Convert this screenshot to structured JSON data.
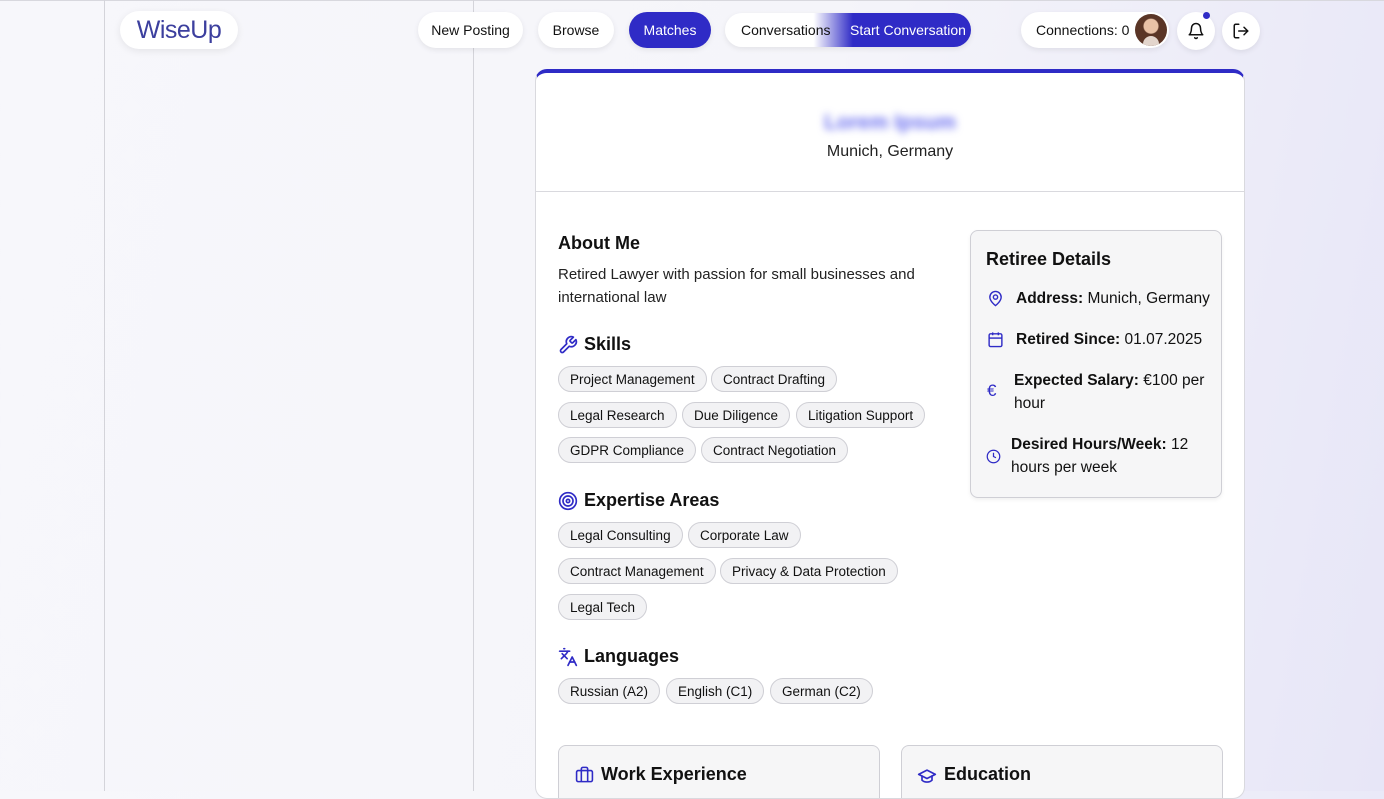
{
  "brand": {
    "logo_text": "WiseUp",
    "accent": "#2f2bc6"
  },
  "nav": {
    "new_posting": "New Posting",
    "browse": "Browse",
    "matches": "Matches",
    "conversations": "Conversations",
    "start_conversation": "Start Conversation",
    "connections": "Connections: 0"
  },
  "profile": {
    "name": "Lorem Ipsum",
    "location": "Munich, Germany",
    "about_title": "About Me",
    "about_text": "Retired Lawyer with passion for small businesses and international law",
    "skills_title": "Skills",
    "skills": [
      "Project Management",
      "Contract Drafting",
      "Legal Research",
      "Due Diligence",
      "Litigation Support",
      "GDPR Compliance",
      "Contract Negotiation"
    ],
    "expertise_title": "Expertise Areas",
    "expertise": [
      "Legal Consulting",
      "Corporate Law",
      "Contract Management",
      "Privacy & Data Protection",
      "Legal Tech"
    ],
    "languages_title": "Languages",
    "languages": [
      "Russian (A2)",
      "English (C1)",
      "German (C2)"
    ],
    "work_title": "Work Experience",
    "education_title": "Education"
  },
  "details": {
    "title": "Retiree Details",
    "address_label": "Address:",
    "address_value": "Munich, Germany",
    "retired_label": "Retired Since:",
    "retired_value": "01.07.2025",
    "salary_label": "Expected Salary:",
    "salary_value": "€100 per hour",
    "hours_label": "Desired Hours/Week:",
    "hours_value": "12 hours per week"
  },
  "icons": [
    "map-pin-icon",
    "calendar-icon",
    "euro-icon",
    "clock-icon",
    "wrench-icon",
    "target-icon",
    "translate-icon",
    "briefcase-icon",
    "graduation-cap-icon",
    "bell-icon",
    "logout-icon"
  ]
}
